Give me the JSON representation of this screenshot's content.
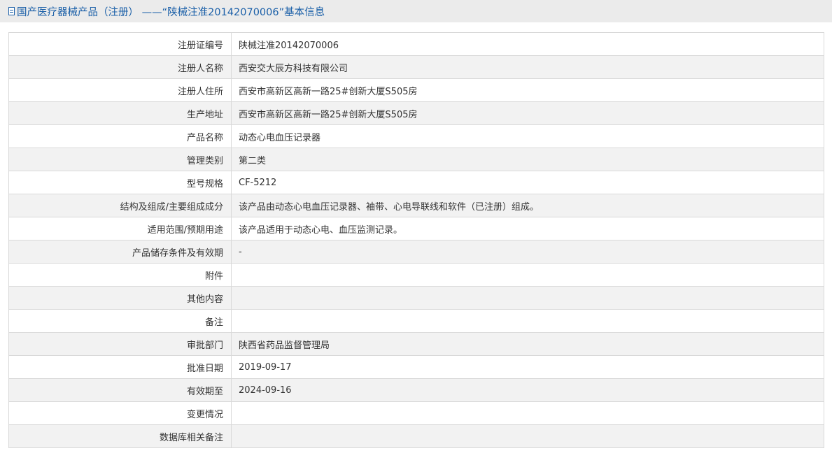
{
  "header": {
    "icon": "document-icon",
    "title": "国产医疗器械产品（注册） ——“陕械注准20142070006”基本信息",
    "color": "#1a5fa8"
  },
  "rows": [
    {
      "label": "注册证编号",
      "value": "陕械注准20142070006"
    },
    {
      "label": "注册人名称",
      "value": "西安交大辰方科技有限公司"
    },
    {
      "label": "注册人住所",
      "value": "西安市高新区高新一路25#创新大厦S505房"
    },
    {
      "label": "生产地址",
      "value": "西安市高新区高新一路25#创新大厦S505房"
    },
    {
      "label": "产品名称",
      "value": "动态心电血压记录器"
    },
    {
      "label": "管理类别",
      "value": "第二类"
    },
    {
      "label": "型号规格",
      "value": "CF-5212"
    },
    {
      "label": "结构及组成/主要组成成分",
      "value": "该产品由动态心电血压记录器、袖带、心电导联线和软件（已注册）组成。"
    },
    {
      "label": "适用范围/预期用途",
      "value": "该产品适用于动态心电、血压监测记录。"
    },
    {
      "label": "产品储存条件及有效期",
      "value": "-"
    },
    {
      "label": "附件",
      "value": ""
    },
    {
      "label": "其他内容",
      "value": ""
    },
    {
      "label": "备注",
      "value": ""
    },
    {
      "label": "审批部门",
      "value": "陕西省药品监督管理局"
    },
    {
      "label": "批准日期",
      "value": "2019-09-17"
    },
    {
      "label": "有效期至",
      "value": "2024-09-16"
    },
    {
      "label": "变更情况",
      "value": ""
    },
    {
      "label": "数据库相关备注",
      "value": ""
    }
  ]
}
